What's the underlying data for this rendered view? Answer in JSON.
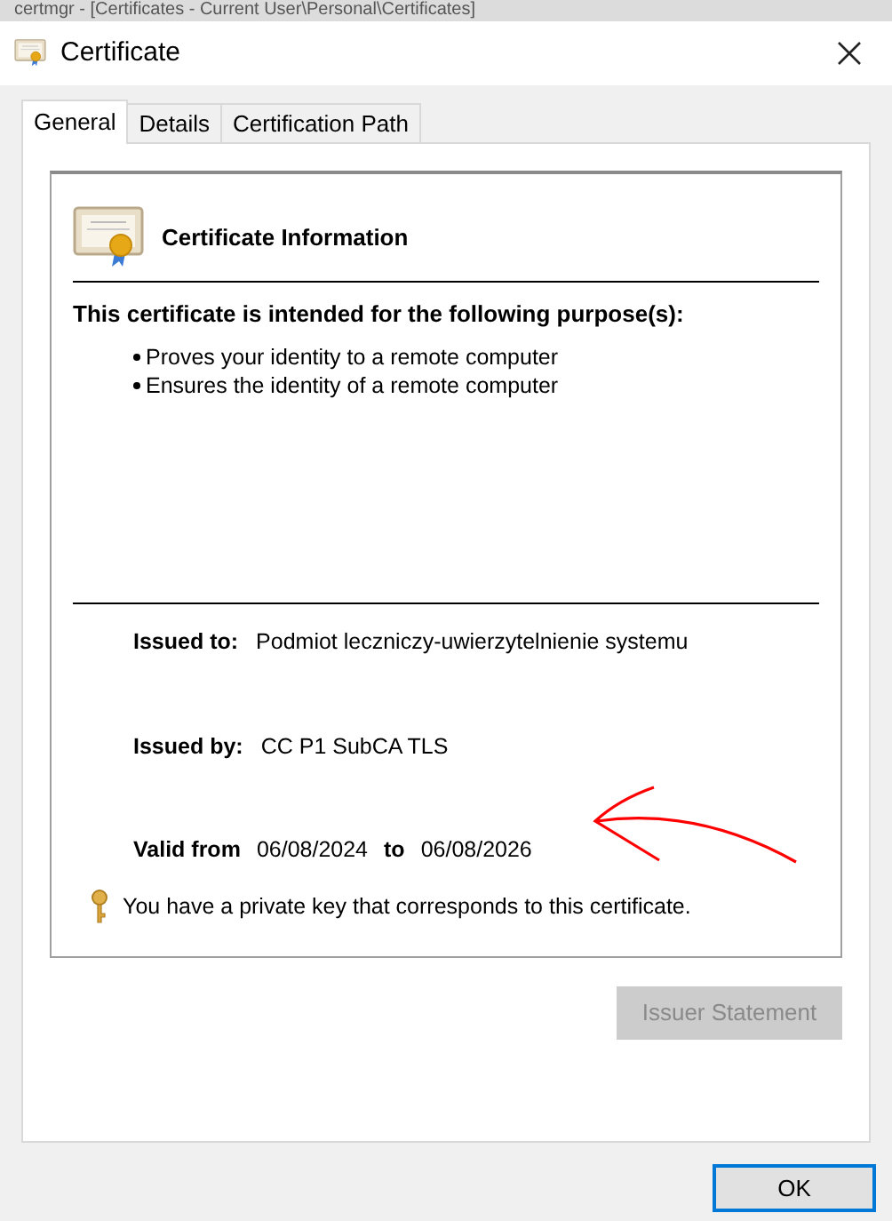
{
  "background_window": {
    "title": "certmgr - [Certificates - Current User\\Personal\\Certificates]"
  },
  "window": {
    "title": "Certificate"
  },
  "tabs": [
    {
      "label": "General",
      "selected": true
    },
    {
      "label": "Details",
      "selected": false
    },
    {
      "label": "Certification Path",
      "selected": false
    }
  ],
  "info": {
    "heading": "Certificate Information",
    "purpose_heading": "This certificate is intended for the following purpose(s):",
    "purposes": [
      "Proves your identity to a remote computer",
      "Ensures the identity of a remote computer"
    ],
    "issued_to_label": "Issued to:",
    "issued_to": "Podmiot leczniczy-uwierzytelnienie systemu",
    "issued_by_label": "Issued by:",
    "issued_by": "CC P1 SubCA TLS",
    "valid_from_label": "Valid from",
    "valid_from": "06/08/2024",
    "valid_to_label": "to",
    "valid_to": "06/08/2026",
    "private_key_note": "You have a private key that corresponds to this certificate."
  },
  "buttons": [
    {
      "label": "Issuer Statement",
      "disabled": true
    },
    {
      "label": "OK",
      "disabled": false
    }
  ]
}
